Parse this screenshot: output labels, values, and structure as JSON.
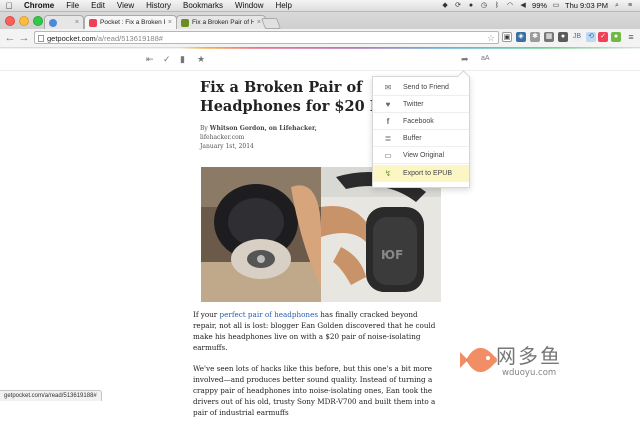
{
  "menubar": {
    "app_name": "Chrome",
    "menus": [
      "File",
      "Edit",
      "View",
      "History",
      "Bookmarks",
      "Window",
      "Help"
    ],
    "battery": "99%",
    "clock": "Thu 9:03 PM"
  },
  "tabs": [
    {
      "title": "",
      "favicon_color": "#4b8ad6"
    },
    {
      "title": "Pocket : Fix a Broken Pair o",
      "favicon_color": "#ef4056"
    },
    {
      "title": "Fix a Broken Pair of Headp",
      "favicon_color": "#6b8e23"
    }
  ],
  "omnibox": {
    "host": "getpocket.com",
    "path": "/a/read/513619188#"
  },
  "article": {
    "headline": "Fix a Broken Pair of Headphones for $20 Earmuffs",
    "byline_prefix": "By",
    "author": "Whitson Gordon, on Lifehacker,",
    "source": "lifehacker.com",
    "date": "January 1st, 2014",
    "p1_pre": "If your ",
    "p1_link": "perfect pair of headphones",
    "p1_post": " has finally cracked beyond repair, not all is lost: blogger Ean Golden discovered that he could make his headphones live on with a $20 pair of noise-isolating earmuffs.",
    "p2": "We've seen lots of hacks like this before, but this one's a bit more involved—and produces better sound quality. Instead of turning a crappy pair of headphones into noise-isolating ones, Ean took the drivers out of his old, trusty Sony MDR-V700 and built them into a pair of industrial earmuffs"
  },
  "reader_toolbar": {
    "font_control": "aA"
  },
  "share_menu": [
    {
      "label": "Send to Friend",
      "icon": "mail-icon"
    },
    {
      "label": "Twitter",
      "icon": "twitter-icon"
    },
    {
      "label": "Facebook",
      "icon": "facebook-icon"
    },
    {
      "label": "Buffer",
      "icon": "buffer-icon"
    },
    {
      "label": "View Original",
      "icon": "view-original-icon"
    },
    {
      "label": "Export to EPUB",
      "icon": "epub-icon"
    }
  ],
  "status_bar": "getpocket.com/a/read/513619188#",
  "watermark": {
    "text": "网多鱼",
    "url": "wduoyu.com"
  }
}
